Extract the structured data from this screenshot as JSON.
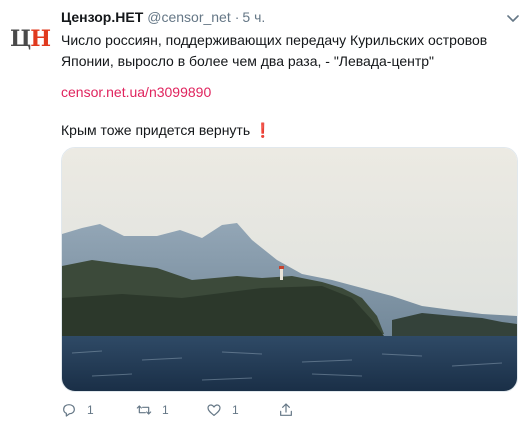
{
  "tweet": {
    "avatar_letters": [
      "Ц",
      "Н"
    ],
    "name": "Цензор.НЕТ",
    "handle": "@censor_net",
    "separator": "·",
    "time": "5 ч.",
    "text": "Число россиян, поддерживающих передачу Курильских островов Японии, выросло в более чем два раза, - \"Левада-центр\"",
    "link": "censor.net.ua/n3099890",
    "line2": "Крым тоже придется вернуть",
    "line2_emoji": "❗",
    "actions": {
      "reply_count": "1",
      "retweet_count": "1",
      "like_count": "1"
    }
  },
  "colors": {
    "text": "#14171a",
    "muted": "#657786",
    "link": "#e0245e",
    "logo_red": "#e03a1e"
  },
  "icons": [
    "reply-icon",
    "retweet-icon",
    "like-icon",
    "share-icon",
    "chevron-down-icon"
  ]
}
